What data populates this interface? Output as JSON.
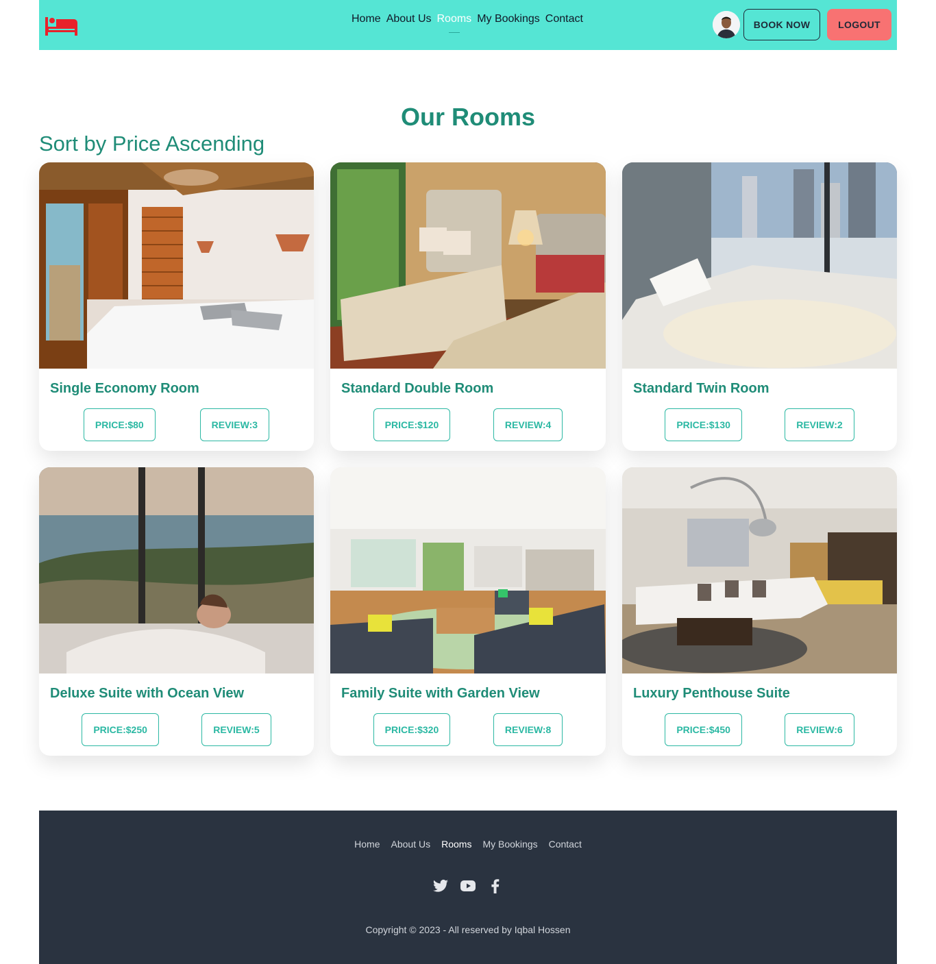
{
  "header": {
    "nav": [
      {
        "label": "Home"
      },
      {
        "label": "About Us"
      },
      {
        "label": "Rooms"
      },
      {
        "label": "My Bookings"
      },
      {
        "label": "Contact"
      }
    ],
    "active_nav": "Rooms",
    "book_now_label": "BOOK NOW",
    "logout_label": "LOGOUT"
  },
  "main": {
    "title": "Our Rooms",
    "sort_label": "Sort by Price Ascending",
    "rooms": [
      {
        "name": "Single Economy Room",
        "price": "PRICE:$80",
        "review": "REVIEW:3"
      },
      {
        "name": "Standard Double Room",
        "price": "PRICE:$120",
        "review": "REVIEW:4"
      },
      {
        "name": "Standard Twin Room",
        "price": "PRICE:$130",
        "review": "REVIEW:2"
      },
      {
        "name": "Deluxe Suite with Ocean View",
        "price": "PRICE:$250",
        "review": "REVIEW:5"
      },
      {
        "name": "Family Suite with Garden View",
        "price": "PRICE:$320",
        "review": "REVIEW:8"
      },
      {
        "name": "Luxury Penthouse Suite",
        "price": "PRICE:$450",
        "review": "REVIEW:6"
      }
    ]
  },
  "footer": {
    "links": [
      {
        "label": "Home"
      },
      {
        "label": "About Us"
      },
      {
        "label": "Rooms"
      },
      {
        "label": "My Bookings"
      },
      {
        "label": "Contact"
      }
    ],
    "social_icons": [
      "twitter-icon",
      "youtube-icon",
      "facebook-icon"
    ],
    "copyright": "Copyright © 2023 - All reserved by Iqbal Hossen"
  },
  "colors": {
    "navbar_bg": "#55e5d4",
    "accent": "#1f8c77",
    "button_outline": "#2bb8a3",
    "logout_bg": "#f87272",
    "logo": "#e8222b",
    "footer_bg": "#2a3340"
  }
}
